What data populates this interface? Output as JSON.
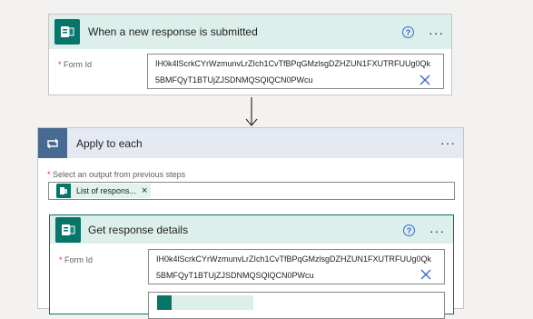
{
  "trigger": {
    "title": "When a new response is submitted",
    "help_icon": "?",
    "more_icon": "···",
    "form_label": "Form Id",
    "required_mark": "*",
    "form_value_line1": "IH0k4lScrkCYrWzmunvLrZIch1CvTfBPqGMzlsgDZHZUN1FXUTRFUUg0Qk",
    "form_value_line2": "5BMFQyT1BTUjZJSDNMQSQlQCN0PWcu",
    "clear_icon": "clear-x-icon"
  },
  "apply_each": {
    "title": "Apply to each",
    "more_icon": "···",
    "select_label": "Select an output from previous steps",
    "required_mark": "*",
    "token_label": "List of respons...",
    "token_remove": "×"
  },
  "get_details": {
    "title": "Get response details",
    "help_icon": "?",
    "more_icon": "···",
    "form_label": "Form Id",
    "required_mark": "*",
    "form_value_line1": "IH0k4lScrkCYrWzmunvLrZIch1CvTfBPqGMzlsgDZHZUN1FXUTRFUUg0Qk",
    "form_value_line2": "5BMFQyT1BTUjZJSDNMQSQlQCN0PWcu",
    "clear_icon": "clear-x-icon"
  },
  "colors": {
    "forms_green": "#077568",
    "forms_header_bg": "#dcefeb",
    "apply_header_bg": "#e4e9f2",
    "apply_icon_bg": "#486991",
    "link_blue": "#3b66d6"
  }
}
